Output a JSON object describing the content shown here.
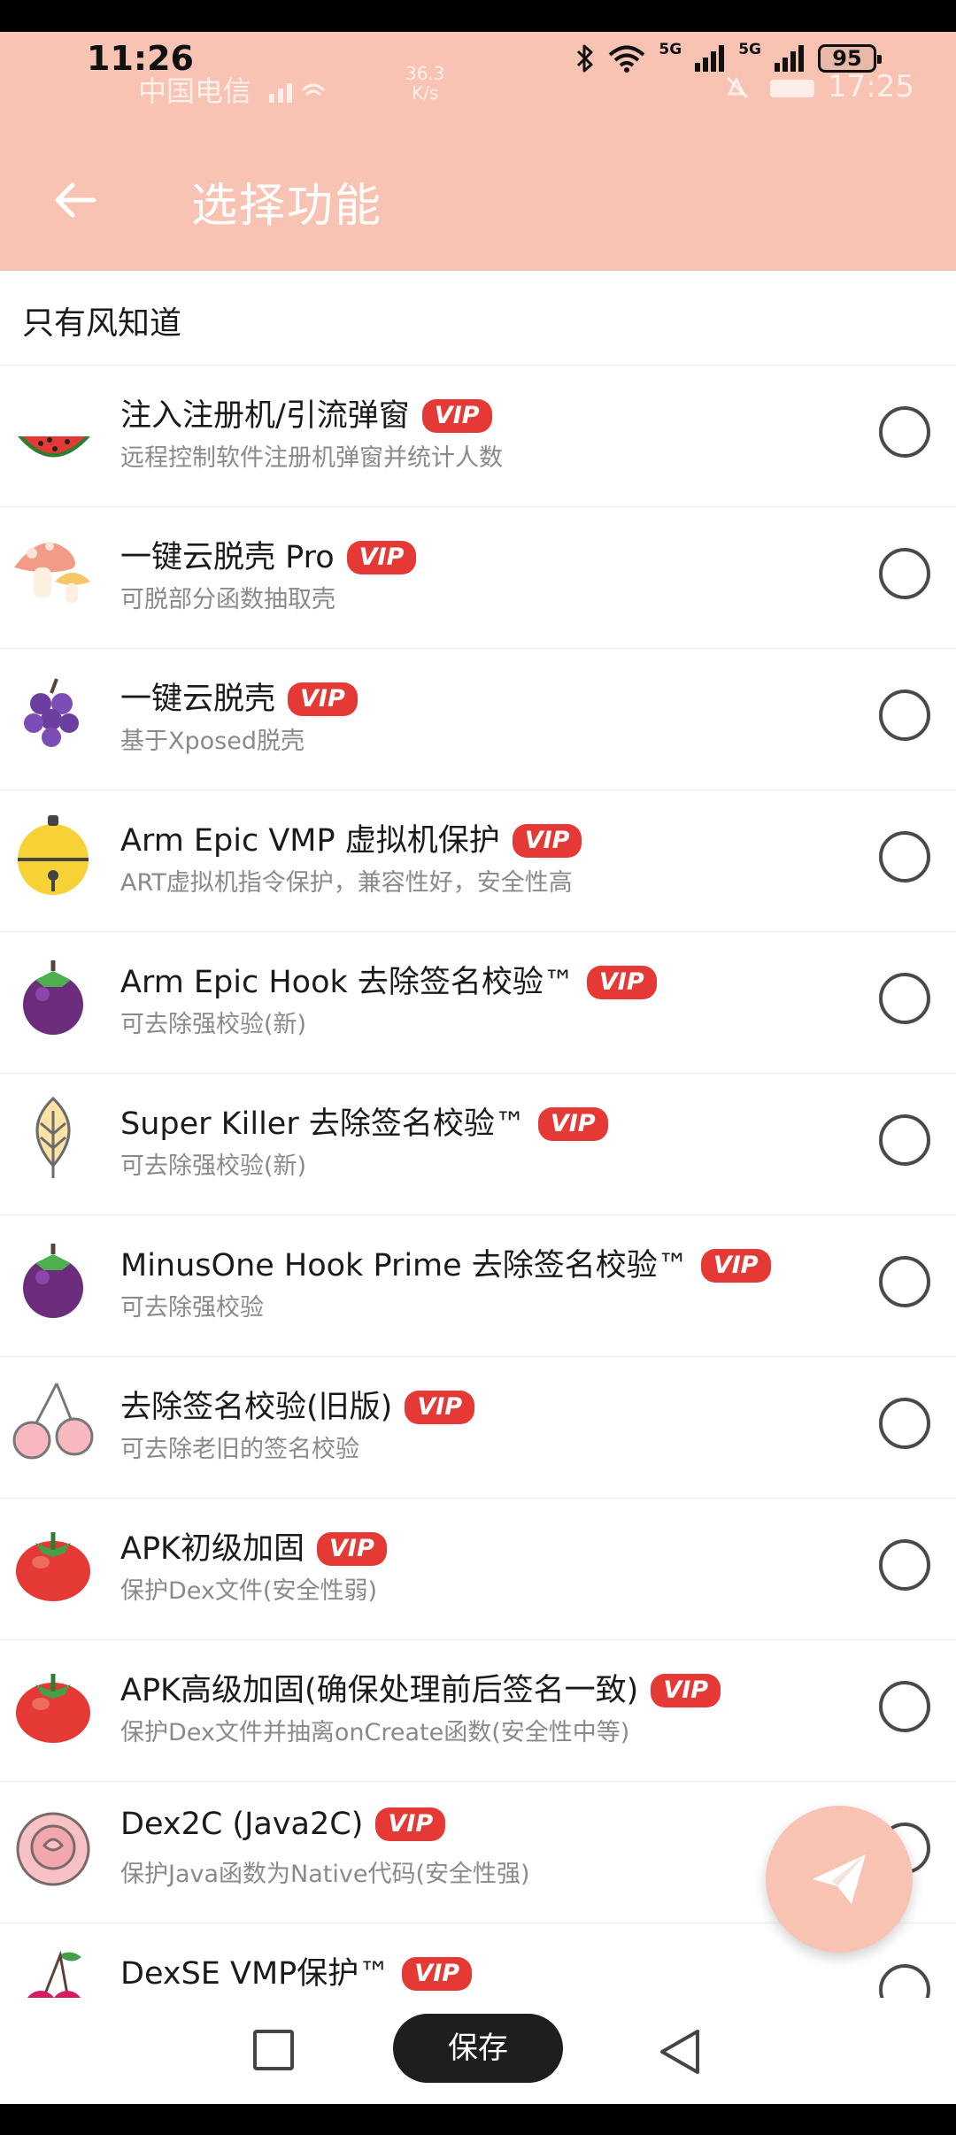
{
  "status_bar": {
    "time": "11:26",
    "network_label": "5G",
    "battery": "95",
    "ghost_carrier": "中国电信",
    "ghost_speed_value": "36.3",
    "ghost_speed_unit": "K/s",
    "ghost_time": "17:25"
  },
  "app_bar": {
    "back_icon": "arrow-left-icon",
    "title": "选择功能",
    "color": "#f8c3b2"
  },
  "section": {
    "header": "只有风知道"
  },
  "vip_label": "VIP",
  "items": [
    {
      "title": "注入注册机/引流弹窗",
      "subtitle": "远程控制软件注册机弹窗并统计人数",
      "icon": "watermelon-icon",
      "vip": true,
      "selected": false
    },
    {
      "title": "一键云脱壳 Pro",
      "subtitle": "可脱部分函数抽取壳",
      "icon": "mushroom-icon",
      "vip": true,
      "selected": false
    },
    {
      "title": "一键云脱壳",
      "subtitle": "基于Xposed脱壳",
      "icon": "grapes-icon",
      "vip": true,
      "selected": false
    },
    {
      "title": "Arm Epic VMP 虚拟机保护",
      "subtitle": "ART虚拟机指令保护，兼容性好，安全性高",
      "icon": "bell-icon",
      "vip": true,
      "selected": false
    },
    {
      "title": "Arm Epic Hook 去除签名校验™",
      "subtitle": "可去除强校验(新)",
      "icon": "mangosteen-icon",
      "vip": true,
      "selected": false
    },
    {
      "title": "Super Killer 去除签名校验™",
      "subtitle": "可去除强校验(新)",
      "icon": "leaf-icon",
      "vip": true,
      "selected": false
    },
    {
      "title": "MinusOne Hook Prime 去除签名校验™",
      "subtitle": "可去除强校验",
      "icon": "mangosteen-icon",
      "vip": true,
      "selected": false
    },
    {
      "title": "去除签名校验(旧版)",
      "subtitle": "可去除老旧的签名校验",
      "icon": "cherries-icon",
      "vip": true,
      "selected": false
    },
    {
      "title": "APK初级加固",
      "subtitle": "保护Dex文件(安全性弱)",
      "icon": "tomato-icon",
      "vip": true,
      "selected": false
    },
    {
      "title": "APK高级加固(确保处理前后签名一致)",
      "subtitle": "保护Dex文件并抽离onCreate函数(安全性中等)",
      "icon": "tomato-icon",
      "vip": true,
      "selected": false
    },
    {
      "title": "Dex2C (Java2C)",
      "subtitle": "保护Java函数为Native代码(安全性强)",
      "icon": "rose-icon",
      "vip": true,
      "selected": false
    },
    {
      "title": "DexSE VMP保护™",
      "subtitle": "",
      "icon": "cherry-icon",
      "vip": true,
      "selected": false
    }
  ],
  "fab": {
    "icon": "send-icon"
  },
  "nav": {
    "recent_icon": "square-icon",
    "save_label": "保存",
    "back_icon": "triangle-back-icon"
  }
}
